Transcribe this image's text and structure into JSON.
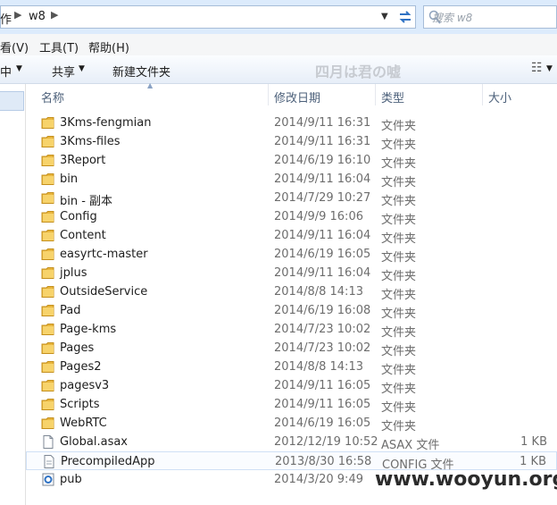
{
  "address": {
    "crumb_left": "作",
    "crumb_current": "w8",
    "search_placeholder": "搜索 w8"
  },
  "menu": {
    "view": "看(V)",
    "tools": "工具(T)",
    "help": "帮助(H)"
  },
  "toolbar": {
    "left_cut": "中",
    "share": "共享",
    "new_folder": "新建文件夹",
    "overlay_text": "四月は君の嘘"
  },
  "columns": {
    "name": "名称",
    "date": "修改日期",
    "type": "类型",
    "size": "大小"
  },
  "files": [
    {
      "name": "3Kms-fengmian",
      "date": "2014/9/11 16:31",
      "type": "文件夹",
      "size": "",
      "icon": "folder-icon"
    },
    {
      "name": "3Kms-files",
      "date": "2014/9/11 16:31",
      "type": "文件夹",
      "size": "",
      "icon": "folder-icon"
    },
    {
      "name": "3Report",
      "date": "2014/6/19 16:10",
      "type": "文件夹",
      "size": "",
      "icon": "folder-icon"
    },
    {
      "name": "bin",
      "date": "2014/9/11 16:04",
      "type": "文件夹",
      "size": "",
      "icon": "folder-icon"
    },
    {
      "name": "bin - 副本",
      "date": "2014/7/29 10:27",
      "type": "文件夹",
      "size": "",
      "icon": "folder-icon"
    },
    {
      "name": "Config",
      "date": "2014/9/9 16:06",
      "type": "文件夹",
      "size": "",
      "icon": "folder-icon"
    },
    {
      "name": "Content",
      "date": "2014/9/11 16:04",
      "type": "文件夹",
      "size": "",
      "icon": "folder-icon"
    },
    {
      "name": "easyrtc-master",
      "date": "2014/6/19 16:05",
      "type": "文件夹",
      "size": "",
      "icon": "folder-icon"
    },
    {
      "name": "jplus",
      "date": "2014/9/11 16:04",
      "type": "文件夹",
      "size": "",
      "icon": "folder-icon"
    },
    {
      "name": "OutsideService",
      "date": "2014/8/8 14:13",
      "type": "文件夹",
      "size": "",
      "icon": "folder-icon"
    },
    {
      "name": "Pad",
      "date": "2014/6/19 16:08",
      "type": "文件夹",
      "size": "",
      "icon": "folder-icon"
    },
    {
      "name": "Page-kms",
      "date": "2014/7/23 10:02",
      "type": "文件夹",
      "size": "",
      "icon": "folder-icon"
    },
    {
      "name": "Pages",
      "date": "2014/7/23 10:02",
      "type": "文件夹",
      "size": "",
      "icon": "folder-icon"
    },
    {
      "name": "Pages2",
      "date": "2014/8/8 14:13",
      "type": "文件夹",
      "size": "",
      "icon": "folder-icon"
    },
    {
      "name": "pagesv3",
      "date": "2014/9/11 16:05",
      "type": "文件夹",
      "size": "",
      "icon": "folder-icon"
    },
    {
      "name": "Scripts",
      "date": "2014/9/11 16:05",
      "type": "文件夹",
      "size": "",
      "icon": "folder-icon"
    },
    {
      "name": "WebRTC",
      "date": "2014/6/19 16:05",
      "type": "文件夹",
      "size": "",
      "icon": "folder-icon"
    },
    {
      "name": "Global.asax",
      "date": "2012/12/19 10:52",
      "type": "ASAX 文件",
      "size": "1 KB",
      "icon": "file-icon"
    },
    {
      "name": "PrecompiledApp",
      "date": "2013/8/30 16:58",
      "type": "CONFIG 文件",
      "size": "1 KB",
      "icon": "config-file-icon"
    },
    {
      "name": "pub",
      "date": "2014/3/20 9:49",
      "type": "",
      "size": "",
      "icon": "app-file-icon"
    }
  ],
  "watermark": {
    "text": "www.wooyun.org"
  }
}
